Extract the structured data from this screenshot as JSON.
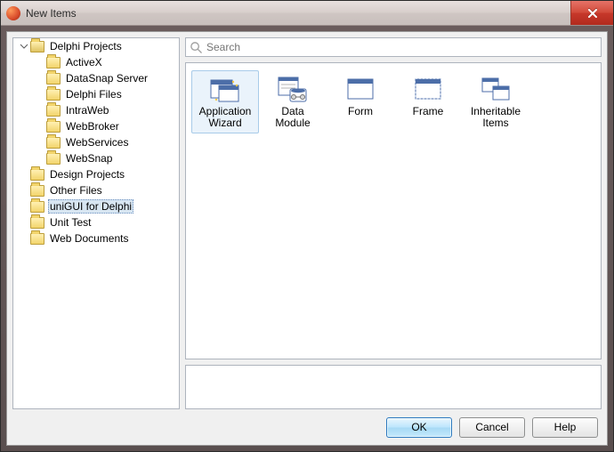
{
  "window": {
    "title": "New Items"
  },
  "tree": [
    {
      "label": "Delphi Projects",
      "open": true,
      "indent": 0,
      "expander": "open",
      "children": [
        {
          "label": "ActiveX",
          "indent": 1
        },
        {
          "label": "DataSnap Server",
          "indent": 1
        },
        {
          "label": "Delphi Files",
          "indent": 1
        },
        {
          "label": "IntraWeb",
          "indent": 1
        },
        {
          "label": "WebBroker",
          "indent": 1
        },
        {
          "label": "WebServices",
          "indent": 1
        },
        {
          "label": "WebSnap",
          "indent": 1
        }
      ]
    },
    {
      "label": "Design Projects",
      "indent": 0
    },
    {
      "label": "Other Files",
      "indent": 0
    },
    {
      "label": "uniGUI for Delphi",
      "indent": 0,
      "selected": true
    },
    {
      "label": "Unit Test",
      "indent": 0
    },
    {
      "label": "Web Documents",
      "indent": 0
    }
  ],
  "search": {
    "placeholder": "Search"
  },
  "items": [
    {
      "label": "Application Wizard",
      "icon": "wizard",
      "selected": true
    },
    {
      "label": "Data Module",
      "icon": "datamodule"
    },
    {
      "label": "Form",
      "icon": "form"
    },
    {
      "label": "Frame",
      "icon": "frame"
    },
    {
      "label": "Inheritable Items",
      "icon": "inherit"
    }
  ],
  "buttons": {
    "ok": "OK",
    "cancel": "Cancel",
    "help": "Help"
  }
}
